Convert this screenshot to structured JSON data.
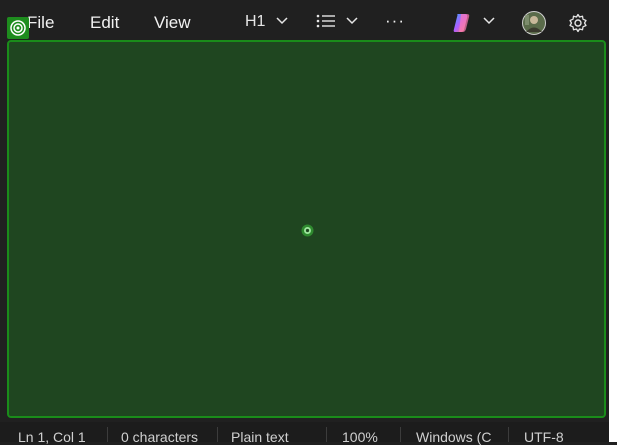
{
  "menu": {
    "file": "File",
    "edit": "Edit",
    "view": "View"
  },
  "toolbar": {
    "heading_value": "H1",
    "more_label": "···",
    "icons": [
      "chevron-down-icon",
      "list-icon",
      "copilot-icon",
      "avatar",
      "gear-icon"
    ]
  },
  "statusbar": {
    "position": "Ln 1, Col 1",
    "characters": "0 characters",
    "format": "Plain text",
    "zoom": "100%",
    "line_ending": "Windows (C",
    "encoding": "UTF-8"
  },
  "colors": {
    "editor_bg": "#1f4620",
    "editor_border": "#1a8c1a",
    "window_bg": "#202020"
  }
}
